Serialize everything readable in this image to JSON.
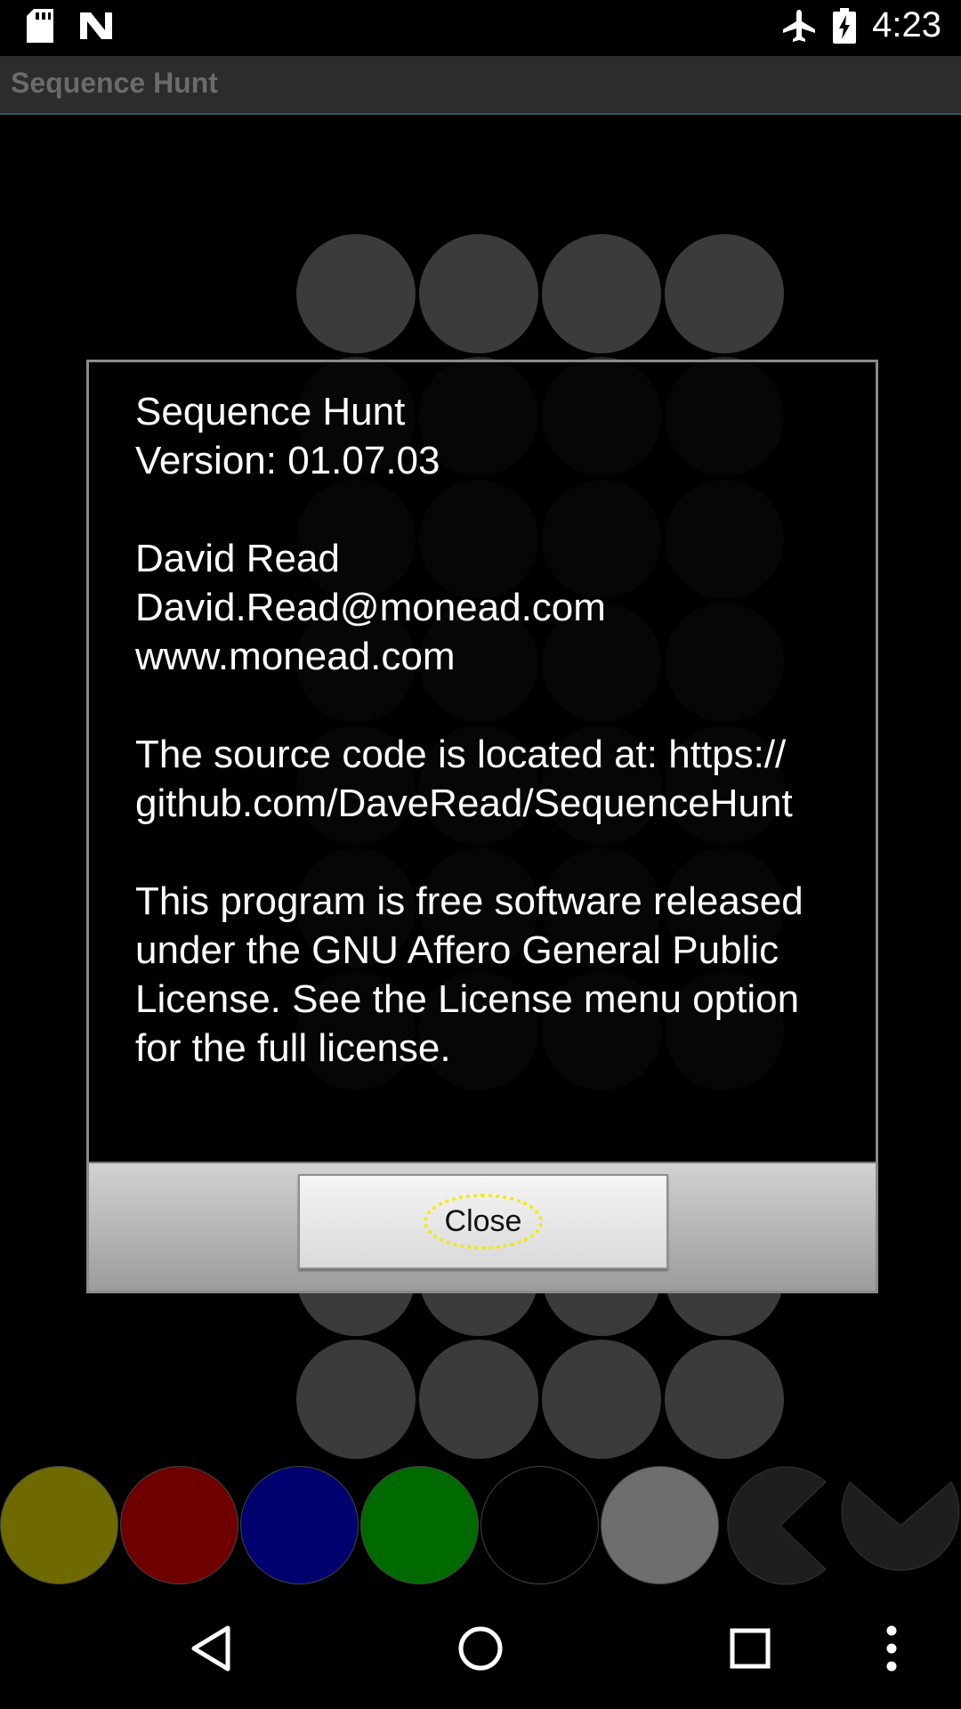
{
  "status_bar": {
    "time": "4:23",
    "icons": [
      "sd-card-icon",
      "n-notification-icon",
      "airplane-mode-icon",
      "battery-charging-icon"
    ]
  },
  "app": {
    "title": "Sequence Hunt"
  },
  "dialog": {
    "app_name": "Sequence Hunt",
    "version": "Version: 01.07.03",
    "author": "David Read",
    "email": "David.Read@monead.com",
    "website": "www.monead.com",
    "source_line": "The source code is located at: https:// github.com/DaveRead/SequenceHunt",
    "license_text": "This program is free software released under the GNU Affero General Public License. See the License menu option for the full license.",
    "close_label": "Close"
  },
  "palette": {
    "colors": [
      "#6e6a00",
      "#6e0000",
      "#00006e",
      "#006a00",
      "#000000",
      "#6e6e6e"
    ],
    "tool_icons": [
      "pacman-eraser-icon",
      "chevron-down-icon"
    ]
  },
  "nav_bar": {
    "buttons": [
      "back-icon",
      "home-icon",
      "recents-icon",
      "menu-icon"
    ]
  }
}
